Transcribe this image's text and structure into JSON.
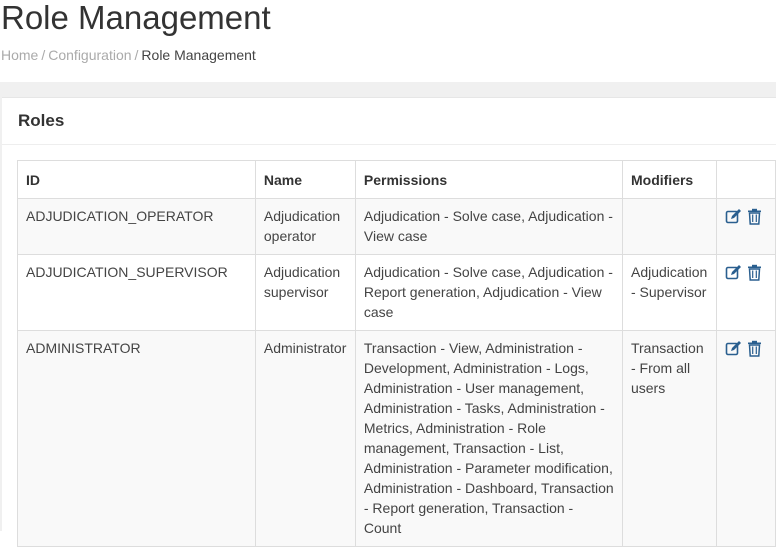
{
  "page": {
    "title": "Role Management"
  },
  "breadcrumb": {
    "home": "Home",
    "configuration": "Configuration",
    "current": "Role Management",
    "separator": "/"
  },
  "box": {
    "title": "Roles"
  },
  "table": {
    "headers": {
      "id": "ID",
      "name": "Name",
      "permissions": "Permissions",
      "modifiers": "Modifiers",
      "actions": ""
    },
    "rows": [
      {
        "id": "ADJUDICATION_OPERATOR",
        "name": "Adjudication operator",
        "permissions": "Adjudication - Solve case, Adjudication - View case",
        "modifiers": ""
      },
      {
        "id": "ADJUDICATION_SUPERVISOR",
        "name": "Adjudication supervisor",
        "permissions": "Adjudication - Solve case, Adjudication - Report generation, Adjudication - View case",
        "modifiers": "Adjudication - Supervisor"
      },
      {
        "id": "ADMINISTRATOR",
        "name": "Administrator",
        "permissions": "Transaction - View, Administration - Development, Administration - Logs, Administration - User management, Administration - Tasks, Administration - Metrics, Administration - Role management, Transaction - List, Administration - Parameter modification, Administration - Dashboard, Transaction - Report generation, Transaction - Count",
        "modifiers": "Transaction - From all users"
      }
    ],
    "row_actions": {
      "edit_icon": "edit-icon",
      "delete_icon": "trash-icon",
      "icon_color": "#2a5f8f"
    }
  }
}
